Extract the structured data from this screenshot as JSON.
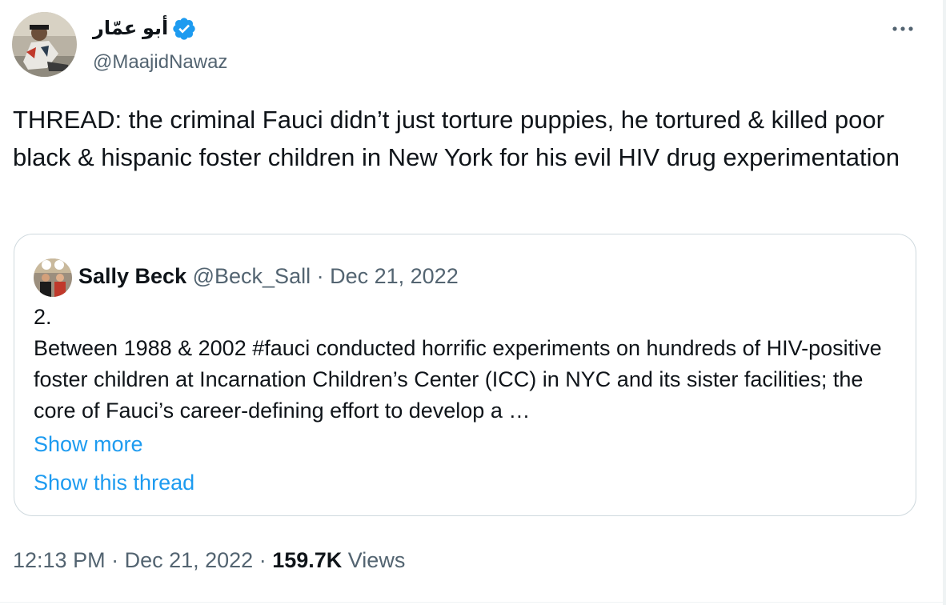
{
  "author": {
    "display_name": "أبو عمّار",
    "handle": "@MaajidNawaz",
    "verified": true
  },
  "tweet": {
    "text": "THREAD: the criminal Fauci didn’t just torture puppies, he tortured & killed poor black & hispanic foster children in New York for his evil HIV drug experimentation"
  },
  "quote": {
    "name": "Sally Beck",
    "handle": "@Beck_Sall",
    "separator": " · ",
    "date": "Dec 21, 2022",
    "number": "2.",
    "text": "Between 1988 & 2002 #fauci conducted horrific experiments on hundreds of HIV-positive foster children at Incarnation Children’s Center (ICC) in NYC and its sister facilities; the core of Fauci’s career-defining effort to develop a …",
    "show_more": "Show more",
    "show_thread": "Show this thread"
  },
  "meta": {
    "time": "12:13 PM",
    "sep1": " · ",
    "date": "Dec 21, 2022",
    "sep2": " · ",
    "views_count": "159.7K",
    "views_label": " Views"
  },
  "colors": {
    "accent": "#1d9bf0",
    "secondary_text": "#536471",
    "border": "#cfd9de"
  },
  "icons": {
    "verified": "verified-badge-icon",
    "more": "more-horizontal-icon"
  }
}
